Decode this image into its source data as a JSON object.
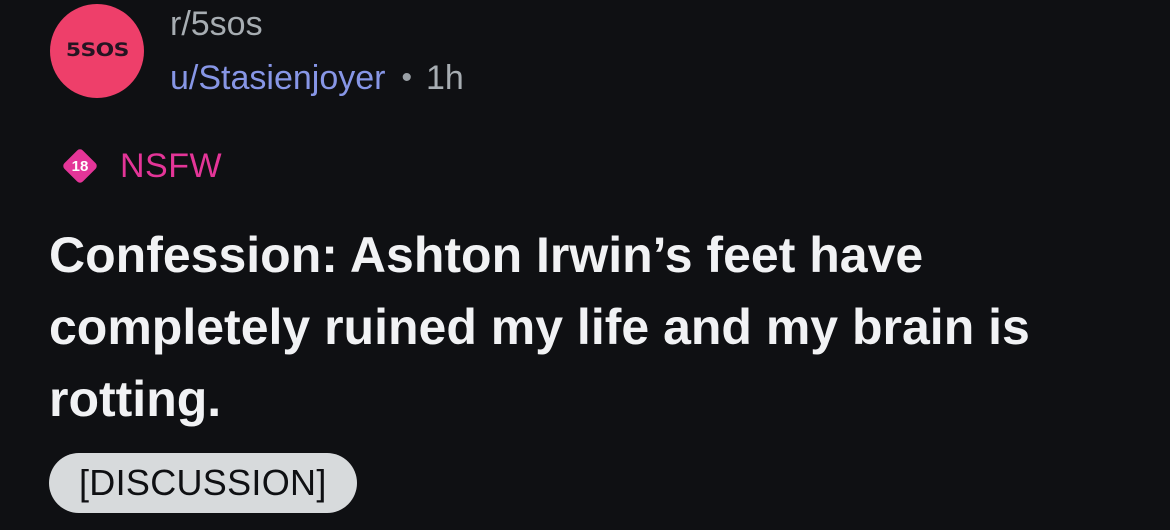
{
  "post": {
    "subreddit": {
      "avatar_text": "5SOS",
      "avatar_color": "#ee3f6a",
      "name": "r/5sos"
    },
    "author": "u/Stasienjoyer",
    "separator": "•",
    "time_ago": "1h",
    "nsfw": {
      "badge_text": "18",
      "badge_icon": "nsfw-diamond-icon",
      "label": "NSFW",
      "color": "#e43598"
    },
    "title": "Confession: Ashton Irwin’s feet have completely ruined my life and my brain is rotting.",
    "flair": "[DISCUSSION]"
  },
  "colors": {
    "background": "#0f1013",
    "author": "#8796e6",
    "muted": "#a7adb2",
    "title": "#f1f2f4",
    "flair_bg": "#d7dadc"
  }
}
